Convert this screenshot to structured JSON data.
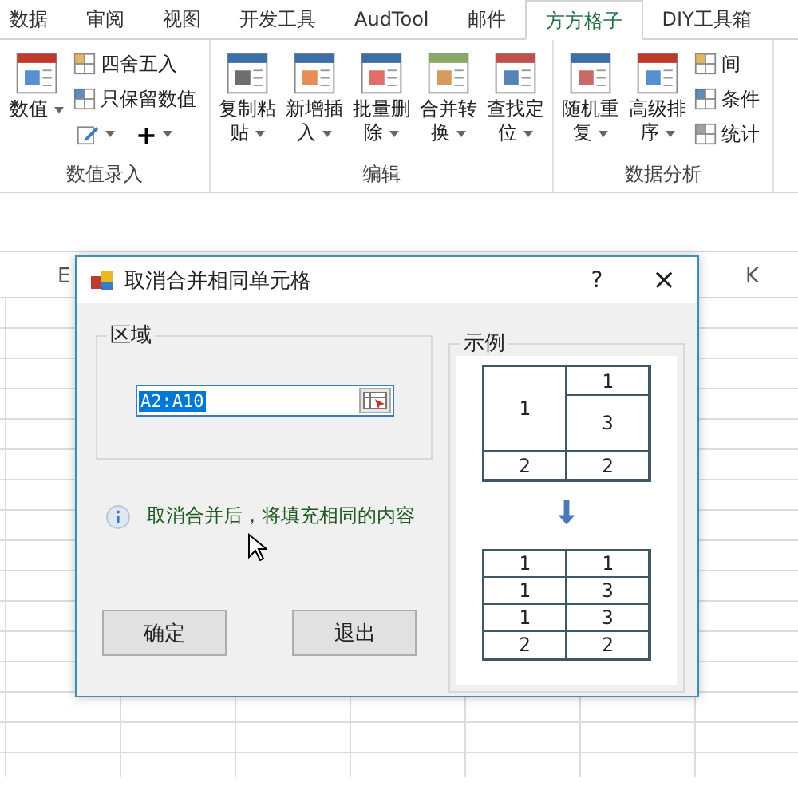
{
  "ribbon": {
    "tabs": [
      {
        "label": "数据",
        "selected": false
      },
      {
        "label": "审阅",
        "selected": false
      },
      {
        "label": "视图",
        "selected": false
      },
      {
        "label": "开发工具",
        "selected": false
      },
      {
        "label": "AudTool",
        "selected": false
      },
      {
        "label": "邮件",
        "selected": false
      },
      {
        "label": "方方格子",
        "selected": true
      },
      {
        "label": "DIY工具箱",
        "selected": false
      }
    ],
    "groups": [
      {
        "label": "数值录入",
        "items": [
          {
            "kind": "large",
            "label": "数值"
          },
          {
            "kind": "small",
            "label": "四舍五入"
          },
          {
            "kind": "small",
            "label": "只保留数值"
          },
          {
            "kind": "tools",
            "label": "+"
          }
        ]
      },
      {
        "label": "编辑",
        "items": [
          {
            "kind": "large",
            "label": "复制粘贴"
          },
          {
            "kind": "large",
            "label": "新增插入"
          },
          {
            "kind": "large",
            "label": "批量删除"
          },
          {
            "kind": "large",
            "label": "合并转换"
          },
          {
            "kind": "large",
            "label": "查找定位"
          }
        ]
      },
      {
        "label": "数据分析",
        "items": [
          {
            "kind": "large",
            "label": "随机重复"
          },
          {
            "kind": "large",
            "label": "高级排序"
          },
          {
            "kind": "small",
            "label": "间"
          },
          {
            "kind": "small",
            "label": "条件"
          },
          {
            "kind": "small",
            "label": "统计"
          }
        ]
      }
    ]
  },
  "sheet": {
    "column_headers": [
      "E",
      "K"
    ]
  },
  "dialog": {
    "title": "取消合并相同单元格",
    "help": "?",
    "close": "×",
    "range": {
      "label": "区域",
      "value": "A2:A10"
    },
    "info": "取消合并后，将填充相同的内容",
    "buttons": [
      "确定",
      "退出"
    ],
    "example": {
      "label": "示例",
      "before": [
        [
          "1",
          "1"
        ],
        [
          "3"
        ],
        [
          "2",
          "2"
        ]
      ],
      "after": [
        [
          "1",
          "1"
        ],
        [
          "1",
          "3"
        ],
        [
          "1",
          "3"
        ],
        [
          "2",
          "2"
        ]
      ]
    }
  }
}
